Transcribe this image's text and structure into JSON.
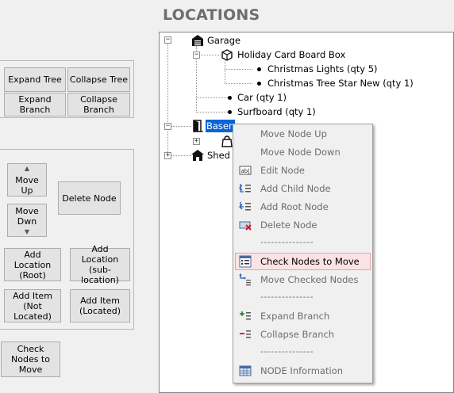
{
  "header": {
    "title": "LOCATIONS"
  },
  "tree_buttons": {
    "expand_tree": "Expand Tree",
    "collapse_tree": "Collapse Tree",
    "expand_branch": "Expand Branch",
    "collapse_branch": "Collapse Branch"
  },
  "node_buttons": {
    "move_up": "Move Up",
    "move_down": "Move Dwn",
    "delete_node": "Delete Node",
    "add_location_root": "Add Location (Root)",
    "add_location_sub": "Add Location (sub-location)",
    "add_item_not_located": "Add Item (Not Located)",
    "add_item_located": "Add Item (Located)",
    "check_nodes_to_move": "Check Nodes to Move"
  },
  "tree": {
    "garage": "Garage",
    "holiday_box": "Holiday Card Board Box",
    "christmas_lights": "Christmas Lights (qty 5)",
    "christmas_star": "Christmas Tree Star New (qty 1)",
    "car": "Car (qty 1)",
    "surfboard": "Surfboard (qty 1)",
    "basement_partial": "Basen",
    "shed": "Shed"
  },
  "context_menu": {
    "items": [
      {
        "label": "Move Node Up",
        "icon": "none"
      },
      {
        "label": "Move Node Down",
        "icon": "none"
      },
      {
        "label": "Edit Node",
        "icon": "edit-text-icon"
      },
      {
        "label": "Add Child Node",
        "icon": "add-child-icon"
      },
      {
        "label": "Add Root Node",
        "icon": "add-root-icon"
      },
      {
        "label": "Delete Node",
        "icon": "delete-node-icon"
      },
      {
        "label": "Check Nodes to Move",
        "icon": "checklist-icon"
      },
      {
        "label": "Move Checked Nodes",
        "icon": "move-checked-icon"
      },
      {
        "label": "Expand Branch",
        "icon": "expand-branch-icon"
      },
      {
        "label": "Collapse Branch",
        "icon": "collapse-branch-icon"
      },
      {
        "label": "NODE Information",
        "icon": "table-info-icon"
      }
    ],
    "separator": "---------------",
    "hovered_item": "Check Nodes to Move"
  },
  "colors": {
    "title": "#6e6e6e",
    "selection": "#0a64d8",
    "menu_hover_bg": "#fbe3e4",
    "menu_hover_border": "#e3a3a7",
    "menu_text_disabled": "#6d6d6d"
  }
}
